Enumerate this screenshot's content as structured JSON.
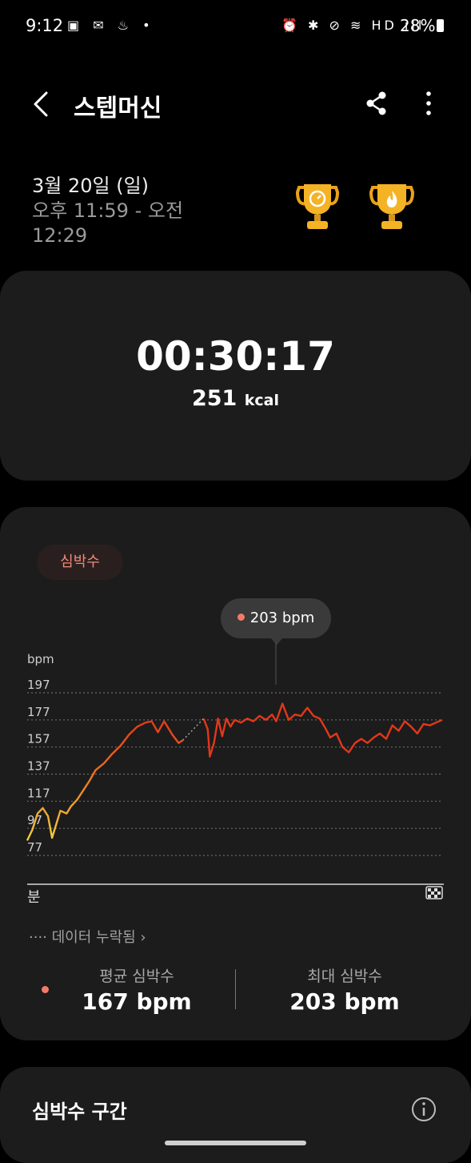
{
  "status_bar": {
    "time": "9:12",
    "left_icons": "▣ ✉ ♨ •",
    "right_icons": "⏰ ✱ ⊘ ≋ HD ıll",
    "battery": "28%"
  },
  "header": {
    "title": "스텝머신"
  },
  "session": {
    "date": "3월 20일 (일)",
    "time_range": "오후 11:59 - 오전 12:29"
  },
  "summary": {
    "duration": "00:30:17",
    "calories": "251",
    "calories_unit": "kcal"
  },
  "heart_rate": {
    "chip_label": "심박수",
    "tooltip": "203 bpm",
    "missing_data": "···· 데이터 누락됨 ›",
    "avg_label": "평균 심박수",
    "avg_value": "167 bpm",
    "max_label": "최대 심박수",
    "max_value": "203 bpm"
  },
  "chart_data": {
    "type": "line",
    "ylabel": "bpm",
    "xlabel": "분",
    "yticks": [
      "197",
      "177",
      "157",
      "137",
      "117",
      "97",
      "77"
    ],
    "ylim": [
      77,
      197
    ],
    "max_marker": 203,
    "series": [
      {
        "color_start": "#f2d13a",
        "color_end": "#e23a1a",
        "points": [
          [
            0.0,
            88
          ],
          [
            0.5,
            96
          ],
          [
            1.0,
            108
          ],
          [
            1.5,
            112
          ],
          [
            2.0,
            106
          ],
          [
            2.4,
            90
          ],
          [
            2.8,
            100
          ],
          [
            3.2,
            110
          ],
          [
            3.8,
            108
          ],
          [
            4.2,
            113
          ],
          [
            4.8,
            118
          ],
          [
            5.4,
            125
          ],
          [
            6.0,
            132
          ],
          [
            6.6,
            140
          ],
          [
            7.4,
            145
          ],
          [
            8.2,
            152
          ],
          [
            9.0,
            158
          ],
          [
            9.8,
            166
          ],
          [
            10.6,
            172
          ],
          [
            11.4,
            175
          ],
          [
            12.0,
            176
          ],
          [
            12.6,
            168
          ],
          [
            13.2,
            176
          ],
          [
            14.0,
            166
          ],
          [
            14.6,
            160
          ],
          [
            15.0,
            162
          ],
          [
            17.0,
            178
          ],
          [
            17.4,
            170
          ],
          [
            17.6,
            150
          ],
          [
            18.0,
            160
          ],
          [
            18.4,
            178
          ],
          [
            18.8,
            165
          ],
          [
            19.2,
            178
          ],
          [
            19.6,
            172
          ],
          [
            20.0,
            177
          ],
          [
            20.6,
            175
          ],
          [
            21.2,
            178
          ],
          [
            21.8,
            176
          ],
          [
            22.4,
            180
          ],
          [
            23.0,
            177
          ],
          [
            23.6,
            181
          ],
          [
            24.0,
            176
          ],
          [
            24.6,
            189
          ],
          [
            25.2,
            177
          ],
          [
            25.8,
            181
          ],
          [
            26.4,
            180
          ],
          [
            27.0,
            186
          ],
          [
            27.6,
            180
          ],
          [
            28.2,
            178
          ],
          [
            28.8,
            170
          ],
          [
            29.2,
            164
          ],
          [
            29.8,
            167
          ],
          [
            30.4,
            157
          ],
          [
            31.0,
            153
          ],
          [
            31.6,
            160
          ],
          [
            32.2,
            163
          ],
          [
            32.8,
            160
          ],
          [
            33.4,
            164
          ],
          [
            34.0,
            167
          ],
          [
            34.6,
            163
          ],
          [
            35.2,
            173
          ],
          [
            35.8,
            169
          ],
          [
            36.4,
            176
          ],
          [
            37.0,
            172
          ],
          [
            37.6,
            167
          ],
          [
            38.2,
            174
          ],
          [
            38.8,
            173
          ],
          [
            39.4,
            175
          ],
          [
            40.0,
            177
          ]
        ],
        "gap": [
          [
            15.0,
            162
          ],
          [
            17.0,
            178
          ]
        ]
      }
    ]
  },
  "zones": {
    "title": "심박수 구간"
  }
}
